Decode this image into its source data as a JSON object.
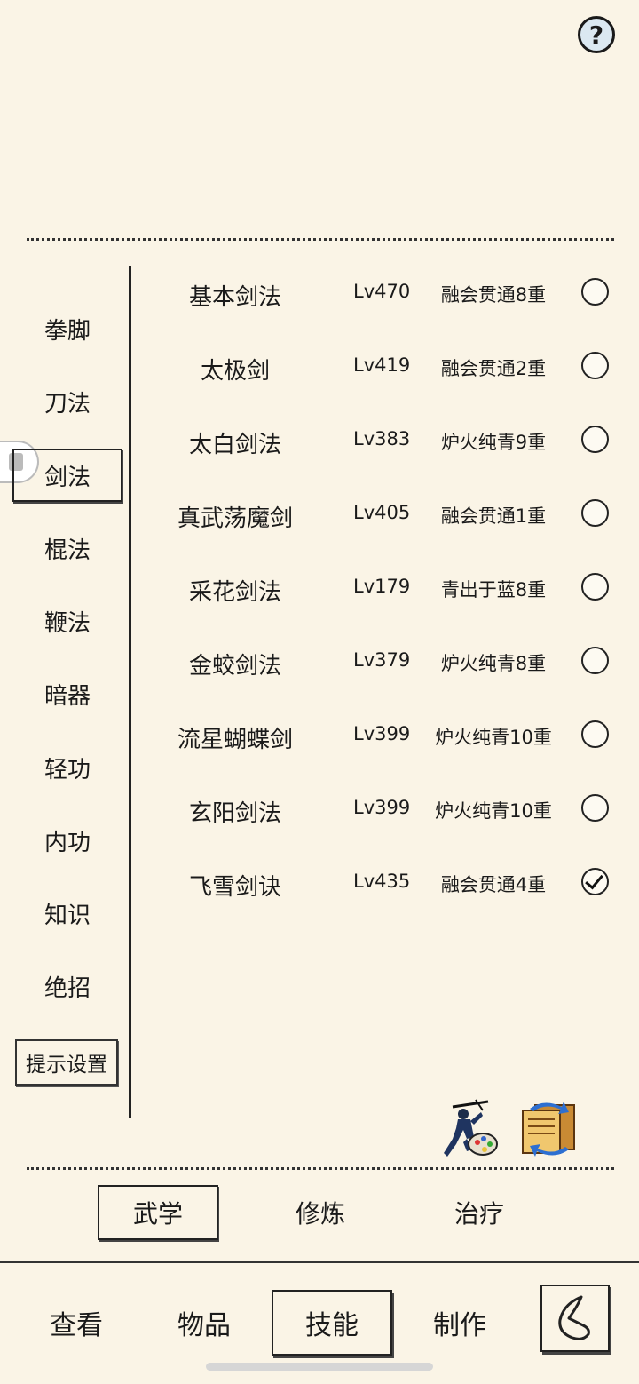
{
  "help": {
    "icon": "help-icon",
    "glyph": "?"
  },
  "categories": [
    {
      "label": "拳脚",
      "active": false
    },
    {
      "label": "刀法",
      "active": false
    },
    {
      "label": "剑法",
      "active": true
    },
    {
      "label": "棍法",
      "active": false
    },
    {
      "label": "鞭法",
      "active": false
    },
    {
      "label": "暗器",
      "active": false
    },
    {
      "label": "轻功",
      "active": false
    },
    {
      "label": "内功",
      "active": false
    },
    {
      "label": "知识",
      "active": false
    },
    {
      "label": "绝招",
      "active": false
    }
  ],
  "hint_settings_label": "提示设置",
  "skills": [
    {
      "name": "基本剑法",
      "level": "Lv470",
      "stage": "融会贯通8重",
      "checked": false
    },
    {
      "name": "太极剑",
      "level": "Lv419",
      "stage": "融会贯通2重",
      "checked": false
    },
    {
      "name": "太白剑法",
      "level": "Lv383",
      "stage": "炉火纯青9重",
      "checked": false
    },
    {
      "name": "真武荡魔剑",
      "level": "Lv405",
      "stage": "融会贯通1重",
      "checked": false
    },
    {
      "name": "采花剑法",
      "level": "Lv179",
      "stage": "青出于蓝8重",
      "checked": false
    },
    {
      "name": "金蛟剑法",
      "level": "Lv379",
      "stage": "炉火纯青8重",
      "checked": false
    },
    {
      "name": "流星蝴蝶剑",
      "level": "Lv399",
      "stage": "炉火纯青10重",
      "checked": false
    },
    {
      "name": "玄阳剑法",
      "level": "Lv399",
      "stage": "炉火纯青10重",
      "checked": false
    },
    {
      "name": "飞雪剑诀",
      "level": "Lv435",
      "stage": "融会贯通4重",
      "checked": true
    }
  ],
  "action_icons": {
    "left": "swordsman-palette-icon",
    "right": "book-swap-icon"
  },
  "subtabs": [
    {
      "label": "武学",
      "active": true
    },
    {
      "label": "修炼",
      "active": false
    },
    {
      "label": "治疗",
      "active": false
    }
  ],
  "nav": [
    {
      "label": "查看",
      "active": false
    },
    {
      "label": "物品",
      "active": false
    },
    {
      "label": "技能",
      "active": true
    },
    {
      "label": "制作",
      "active": false
    }
  ],
  "back_icon": "back-icon"
}
